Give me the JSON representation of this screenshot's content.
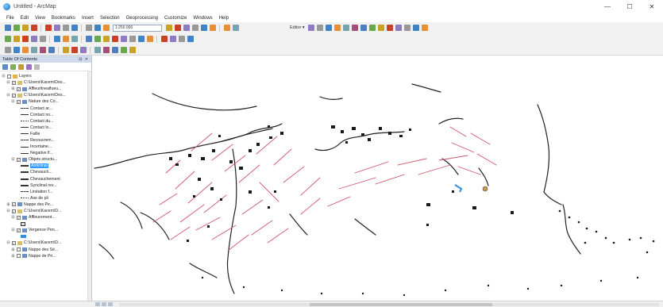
{
  "window": {
    "title": "Untitled - ArcMap",
    "minimize_glyph": "—",
    "maximize_glyph": "☐",
    "close_glyph": "✕"
  },
  "menu": [
    "File",
    "Edit",
    "View",
    "Bookmarks",
    "Insert",
    "Selection",
    "Geoprocessing",
    "Customize",
    "Windows",
    "Help"
  ],
  "toolbar": {
    "scale_value": "1:250 000",
    "editor_label": "Editor ▾"
  },
  "toc": {
    "title": "Table Of Contents",
    "header_buttons": "⊟ ✕",
    "rows": [
      {
        "indent": 2,
        "exp": "⊟",
        "chk": false,
        "icon": "layers-group",
        "label": "Layers"
      },
      {
        "indent": 8,
        "exp": "⊟",
        "chk": true,
        "icon": "group",
        "label": "C:\\Users\\Kacem\\Des..."
      },
      {
        "indent": 14,
        "exp": "⊞",
        "chk": true,
        "icon": "layer",
        "label": "Affleurlineaflueu..."
      },
      {
        "indent": 8,
        "exp": "⊟",
        "chk": true,
        "icon": "group",
        "label": "C:\\Users\\Kacem\\Des..."
      },
      {
        "indent": 14,
        "exp": "⊟",
        "chk": true,
        "icon": "layer",
        "label": "Nature des Co..."
      },
      {
        "indent": 26,
        "sym": "dash",
        "label": "Contact ar..."
      },
      {
        "indent": 26,
        "sym": "line",
        "label": "Contact no..."
      },
      {
        "indent": 26,
        "sym": "dot",
        "label": "Contact du..."
      },
      {
        "indent": 26,
        "sym": "line",
        "label": "Contact lo..."
      },
      {
        "indent": 26,
        "sym": "line",
        "label": "Faille"
      },
      {
        "indent": 26,
        "sym": "dash",
        "label": "Recouvrem..."
      },
      {
        "indent": 26,
        "sym": "line",
        "label": "Incertaine..."
      },
      {
        "indent": 26,
        "sym": "line",
        "label": "Negative fl..."
      },
      {
        "indent": 14,
        "exp": "⊟",
        "chk": true,
        "icon": "layer",
        "label": "Objets structu..."
      },
      {
        "indent": 26,
        "sym": "thick",
        "label": "Anticlinal",
        "selected": true
      },
      {
        "indent": 26,
        "sym": "thick",
        "label": "Chevauch..."
      },
      {
        "indent": 26,
        "sym": "thick",
        "label": "Chevauchement"
      },
      {
        "indent": 26,
        "sym": "thick",
        "label": "Synclinal rev..."
      },
      {
        "indent": 26,
        "sym": "dash",
        "label": "Linéation f..."
      },
      {
        "indent": 26,
        "sym": "dot",
        "label": "Axe de pli"
      },
      {
        "indent": 8,
        "exp": "⊞",
        "chk": true,
        "icon": "layer",
        "label": "Nappe des Pe..."
      },
      {
        "indent": 8,
        "exp": "⊟",
        "chk": true,
        "icon": "group",
        "label": "C:\\Users\\Kacem\\D..."
      },
      {
        "indent": 14,
        "exp": "⊟",
        "chk": true,
        "icon": "layer",
        "label": "Affleurement..."
      },
      {
        "indent": 26,
        "sym": "box",
        "label": ""
      },
      {
        "indent": 14,
        "exp": "⊟",
        "chk": true,
        "icon": "layer",
        "label": "Vergence Pen..."
      },
      {
        "indent": 26,
        "sym": "arrow",
        "label": ""
      },
      {
        "indent": 8,
        "exp": "⊟",
        "chk": true,
        "icon": "group",
        "label": "C:\\Users\\Kacem\\D..."
      },
      {
        "indent": 14,
        "exp": "⊞",
        "chk": false,
        "icon": "layer",
        "label": "Nappe des Sé..."
      },
      {
        "indent": 14,
        "exp": "⊞",
        "chk": false,
        "icon": "layer",
        "label": "Nappe de Pri..."
      }
    ]
  },
  "colors": {
    "accent": "#3399ff",
    "toc_header": "#cfdbec",
    "faults": "#d0576a",
    "contacts": "#222222",
    "vergence": "#2f8fe0",
    "marker": "#c79a4f"
  }
}
